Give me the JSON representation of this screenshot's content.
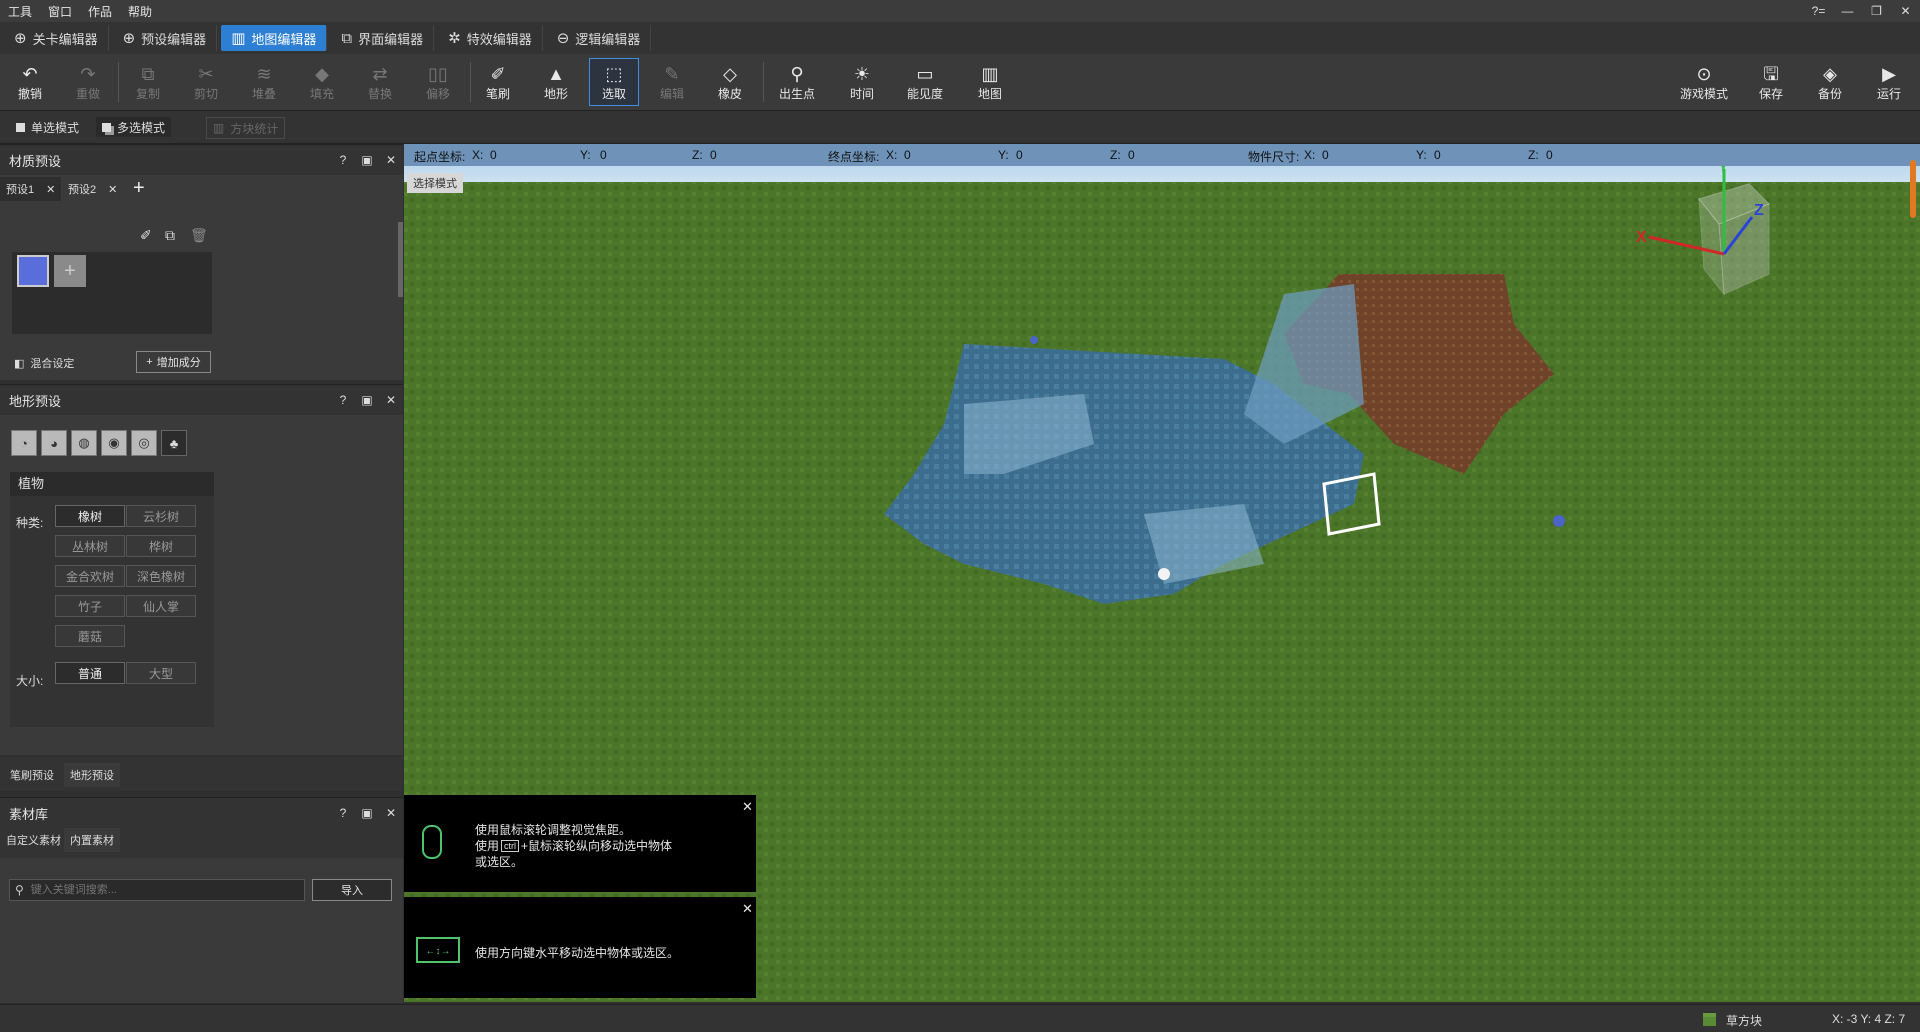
{
  "menu": [
    "工具",
    "窗口",
    "作品",
    "帮助"
  ],
  "window_buttons": [
    "?=",
    "—",
    "❐",
    "✕"
  ],
  "editor_tabs": [
    {
      "label": "关卡编辑器",
      "icon": "level-icon"
    },
    {
      "label": "预设编辑器",
      "icon": "preset-icon"
    },
    {
      "label": "地图编辑器",
      "icon": "map-icon"
    },
    {
      "label": "界面编辑器",
      "icon": "ui-icon"
    },
    {
      "label": "特效编辑器",
      "icon": "effects-icon"
    },
    {
      "label": "逻辑编辑器",
      "icon": "logic-icon"
    }
  ],
  "toolbar": {
    "undo": "撤销",
    "redo": "重做",
    "copy": "复制",
    "cut": "剪切",
    "stack": "堆叠",
    "fill": "填充",
    "replace": "替换",
    "offset": "偏移",
    "brush": "笔刷",
    "terrain": "地形",
    "select": "选取",
    "edit": "编辑",
    "eraser": "橡皮",
    "spawn": "出生点",
    "time": "时间",
    "visibility": "能见度",
    "map": "地图",
    "game_mode": "游戏模式",
    "save": "保存",
    "backup": "备份",
    "run": "运行"
  },
  "modebar": {
    "single": "单选模式",
    "multi": "多选模式",
    "block_stats": "方块统计"
  },
  "material_panel": {
    "title": "材质预设",
    "tabs": [
      "预设1",
      "预设2"
    ],
    "blend": "混合设定",
    "add_component": "增加成分"
  },
  "terrain_panel": {
    "title": "地形预设",
    "section": "植物",
    "type_label": "种类:",
    "types": [
      "橡树",
      "云杉树",
      "丛林树",
      "桦树",
      "金合欢树",
      "深色橡树",
      "竹子",
      "仙人掌",
      "蘑菇"
    ],
    "size_label": "大小:",
    "sizes": [
      "普通",
      "大型"
    ]
  },
  "bottom_tabs": [
    "笔刷预设",
    "地形预设"
  ],
  "asset_panel": {
    "title": "素材库",
    "tabs": [
      "自定义素材",
      "内置素材"
    ],
    "search_placeholder": "键入关键词搜索...",
    "import": "导入"
  },
  "coords": {
    "start_label": "起点坐标:",
    "end_label": "终点坐标:",
    "size_label": "物件尺寸:",
    "x": "X:",
    "y": "Y:",
    "z": "Z:",
    "zero": "0"
  },
  "viewport": {
    "mode_label": "选择模式"
  },
  "hints": {
    "scroll_line1": "使用鼠标滚轮调整视觉焦距。",
    "scroll_line2a": "使用",
    "ctrl": "ctrl",
    "scroll_line2b": "+鼠标滚轮纵向移动选中物体",
    "scroll_line3": "或选区。",
    "arrows": "使用方向键水平移动选中物体或选区。"
  },
  "status": {
    "block": "草方块",
    "coords": "X: -3  Y: 4  Z: 7"
  },
  "colors": {
    "accent": "#2d7fd3",
    "grass": "#4d7a2a",
    "water": "#3f7fb0",
    "dirt": "#7a4a2e"
  }
}
